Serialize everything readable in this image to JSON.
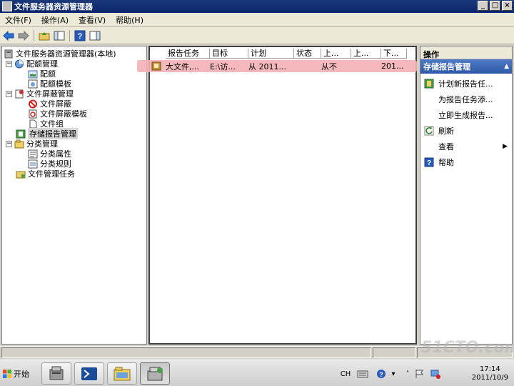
{
  "window": {
    "title": "文件服务器资源管理器",
    "controls": [
      "_",
      "□",
      "×"
    ]
  },
  "menu": [
    "文件(F)",
    "操作(A)",
    "查看(V)",
    "帮助(H)"
  ],
  "tree": {
    "root": "文件服务器资源管理器(本地)",
    "quota_mgmt": "配额管理",
    "quota": "配额",
    "quota_template": "配额模板",
    "screen_mgmt": "文件屏蔽管理",
    "screen": "文件屏蔽",
    "screen_template": "文件屏蔽模板",
    "file_group": "文件组",
    "storage_report": "存储报告管理",
    "class_mgmt": "分类管理",
    "class_props": "分类属性",
    "class_rules": "分类规则",
    "file_mgmt_tasks": "文件管理任务"
  },
  "list": {
    "columns": [
      "报告任务",
      "目标",
      "计划",
      "状态",
      "上...",
      "上...",
      "下..."
    ],
    "rows": [
      [
        "大文件,...",
        "E:\\访...",
        "从 2011...",
        "",
        "从不",
        "",
        "201..."
      ]
    ]
  },
  "actions": {
    "title": "操作",
    "section": "存储报告管理",
    "items": [
      "计划新报告任...",
      "为报告任务添...",
      "立即生成报告...",
      "刷新",
      "查看",
      "帮助"
    ]
  },
  "taskbar": {
    "start": "开始",
    "lang": "CH",
    "time": "17:14",
    "date": "2011/10/9"
  },
  "watermark": "51CTO.com"
}
